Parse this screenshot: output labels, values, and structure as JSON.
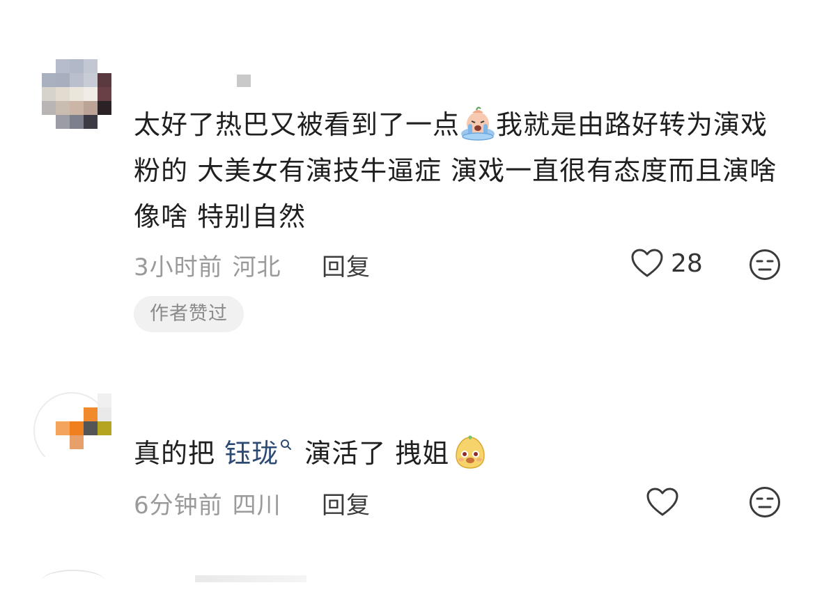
{
  "comments": [
    {
      "text_before_emoji": "太好了热巴又被看到了一点",
      "emoji_name": "crying-emoji",
      "text_after_emoji": "我就是由路好转为演戏粉的 大美女有演技牛逼症 演戏一直很有态度而且演啥像啥 特别自然",
      "time": "3小时前",
      "location": "河北",
      "reply_label": "回复",
      "like_count": "28",
      "badge": "作者赞过"
    },
    {
      "text_before_mention": "真的把 ",
      "mention": "钰珑",
      "text_after_mention": " 演活了 拽姐",
      "emoji_name": "smug-emoji",
      "time": "6分钟前",
      "location": "四川",
      "reply_label": "回复",
      "like_count": ""
    }
  ],
  "colors": {
    "text": "#1f1f1f",
    "meta": "#9a9a9a",
    "mention": "#2c4a73",
    "badge_bg": "#f1f1f1"
  },
  "icons": [
    "heart-icon",
    "dislike-face-icon",
    "search-mention-icon"
  ]
}
